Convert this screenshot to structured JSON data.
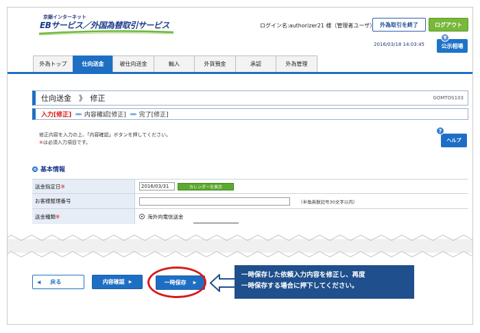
{
  "header": {
    "brand_top": "京銀インターネット",
    "brand_main": "EBサービス／外国為替取引サービス",
    "login_label": "ログイン名:authorizer21 様（管理者ユーザ）",
    "end_fx_button": "外為取引を終了",
    "logout_button": "ログアウト",
    "datetime": "2016/03/18 14:03:45",
    "rate_button": "公示相場",
    "rate_icon_glyph": "¥"
  },
  "tabs": [
    {
      "label": "外為トップ",
      "active": false
    },
    {
      "label": "仕向送金",
      "active": true
    },
    {
      "label": "被仕向送金",
      "active": false
    },
    {
      "label": "輸入",
      "active": false
    },
    {
      "label": "外貨預金",
      "active": false
    },
    {
      "label": "承認",
      "active": false
    },
    {
      "label": "外為管理",
      "active": false
    }
  ],
  "page": {
    "title": "仕向送金　》　修正",
    "screen_id": "GOMTOS103",
    "steps": {
      "current": "入力[修正]",
      "step2": "内容確認[修正]",
      "step3": "完了[修正]",
      "arrow": "»»»"
    },
    "instruction_line1": "修正内容を入力の上、「内容確認」ボタンを押してください。",
    "instruction_line2_mark": "※",
    "instruction_line2": "は必須入力項目です。",
    "help_button": "ヘルプ",
    "help_icon_glyph": "?"
  },
  "section": {
    "heading": "基本情報",
    "fields": {
      "date_label": "送金指定日",
      "date_value": "2016/03/31",
      "calendar_button": "カレンダーを表示",
      "ref_label": "お客様整理番号",
      "ref_note": "（半角英数記号30文字以内）",
      "type_label": "送金種類",
      "type_option": "海外向電信送金",
      "required_mark": "※"
    }
  },
  "footer": {
    "back_button": "戻る",
    "confirm_button": "内容確認",
    "save_button": "一時保存",
    "callout_line1": "一時保存した依頼入力内容を修正し、再度",
    "callout_line2": "一時保存する場合に押下してください。"
  },
  "colors": {
    "accent": "#1e6fc4",
    "highlight": "#d81a1a",
    "logout": "#78b83a",
    "callout": "#1f4f8c"
  }
}
